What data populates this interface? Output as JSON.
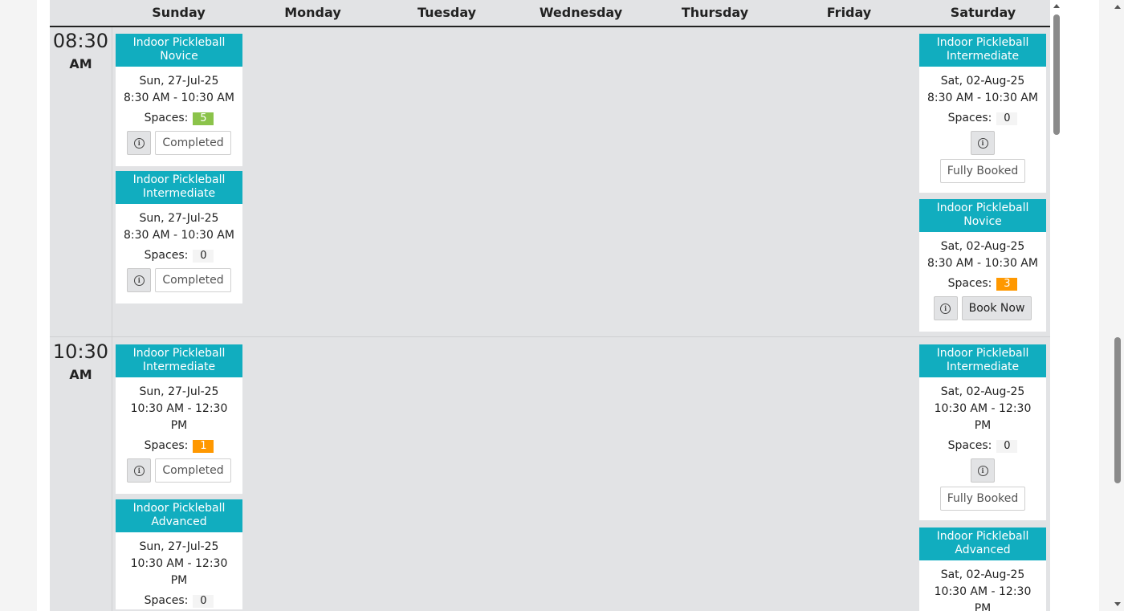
{
  "days": [
    "Sunday",
    "Monday",
    "Tuesday",
    "Wednesday",
    "Thursday",
    "Friday",
    "Saturday"
  ],
  "slots": [
    {
      "time": "08:30",
      "ampm": "AM"
    },
    {
      "time": "10:30",
      "ampm": "AM"
    }
  ],
  "cards": [
    {
      "title_l1": "Indoor Pickleball",
      "title_l2": "Novice",
      "date": "Sun, 27-Jul-25",
      "time_l1": "8:30 AM - 10:30 AM",
      "time_l2": "",
      "spaces_label": "Spaces:",
      "spaces": "5",
      "action": "Completed"
    },
    {
      "title_l1": "Indoor Pickleball",
      "title_l2": "Intermediate",
      "date": "Sun, 27-Jul-25",
      "time_l1": "8:30 AM - 10:30 AM",
      "time_l2": "",
      "spaces_label": "Spaces:",
      "spaces": "0",
      "action": "Completed"
    },
    {
      "title_l1": "Indoor Pickleball",
      "title_l2": "Intermediate",
      "date": "Sat, 02-Aug-25",
      "time_l1": "8:30 AM - 10:30 AM",
      "time_l2": "",
      "spaces_label": "Spaces:",
      "spaces": "0",
      "action": "Fully Booked"
    },
    {
      "title_l1": "Indoor Pickleball",
      "title_l2": "Novice",
      "date": "Sat, 02-Aug-25",
      "time_l1": "8:30 AM - 10:30 AM",
      "time_l2": "",
      "spaces_label": "Spaces:",
      "spaces": "3",
      "action": "Book Now"
    },
    {
      "title_l1": "Indoor Pickleball",
      "title_l2": "Intermediate",
      "date": "Sun, 27-Jul-25",
      "time_l1": "10:30 AM - 12:30",
      "time_l2": "PM",
      "spaces_label": "Spaces:",
      "spaces": "1",
      "action": "Completed"
    },
    {
      "title_l1": "Indoor Pickleball",
      "title_l2": "Advanced",
      "date": "Sun, 27-Jul-25",
      "time_l1": "10:30 AM - 12:30",
      "time_l2": "PM",
      "spaces_label": "Spaces:",
      "spaces": "0",
      "action": ""
    },
    {
      "title_l1": "Indoor Pickleball",
      "title_l2": "Intermediate",
      "date": "Sat, 02-Aug-25",
      "time_l1": "10:30 AM - 12:30",
      "time_l2": "PM",
      "spaces_label": "Spaces:",
      "spaces": "0",
      "action": "Fully Booked"
    },
    {
      "title_l1": "Indoor Pickleball",
      "title_l2": "Advanced",
      "date": "Sat, 02-Aug-25",
      "time_l1": "10:30 AM - 12:30",
      "time_l2": "PM",
      "spaces_label": "",
      "spaces": "",
      "action": ""
    }
  ],
  "colors": {
    "card_header": "#11adbf",
    "badge_green": "#8bc34a",
    "badge_orange": "#ff9800",
    "calendar_bg": "#e2e3e5"
  },
  "icons": {
    "info": "info-circle-icon",
    "info_glyph": "i"
  }
}
